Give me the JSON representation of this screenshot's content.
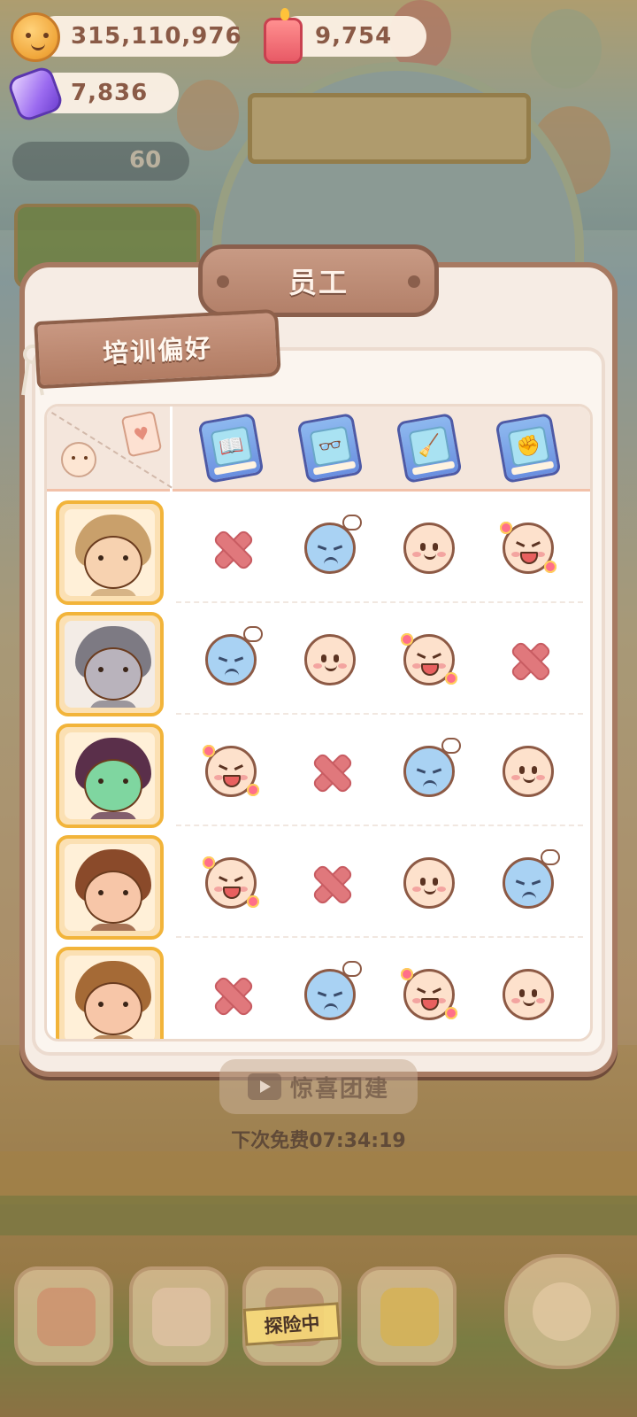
{
  "hud": {
    "coins": "315,110,976",
    "candles": "9,754",
    "gems": "7,836",
    "level_value": "60"
  },
  "dialog": {
    "title": "员工",
    "tab_label": "培训偏好",
    "columns": [
      {
        "icon": "book-open-icon",
        "glyph": "📖"
      },
      {
        "icon": "glasses-book-icon",
        "glyph": "👓"
      },
      {
        "icon": "broom-book-icon",
        "glyph": "🧹"
      },
      {
        "icon": "fist-book-icon",
        "glyph": "✊"
      }
    ],
    "staff": [
      {
        "avatar": "mushroom-hat-girl-avatar",
        "prefs": [
          "dislike",
          "angry",
          "neutral",
          "happy"
        ]
      },
      {
        "avatar": "raccoon-chef-avatar",
        "prefs": [
          "angry",
          "neutral",
          "happy",
          "dislike"
        ]
      },
      {
        "avatar": "witch-avatar",
        "prefs": [
          "happy",
          "dislike",
          "angry",
          "neutral"
        ]
      },
      {
        "avatar": "curly-hair-glasses-avatar",
        "prefs": [
          "happy",
          "dislike",
          "neutral",
          "angry"
        ]
      },
      {
        "avatar": "curly-brown-hair-avatar",
        "prefs": [
          "dislike",
          "angry",
          "happy",
          "neutral"
        ]
      }
    ]
  },
  "bottom": {
    "gift_button_label": "惊喜团建",
    "next_free_timer": "下次免费07:34:19",
    "explore_tag": "探险中"
  },
  "colors": {
    "panel_border": "#a77a62",
    "title_tab": "#b38069",
    "avatar_frame": "#f2b43a",
    "dislike_x": "#e0787c",
    "angry_face": "#a9d2f3",
    "neutral_face": "#fde1cc"
  }
}
